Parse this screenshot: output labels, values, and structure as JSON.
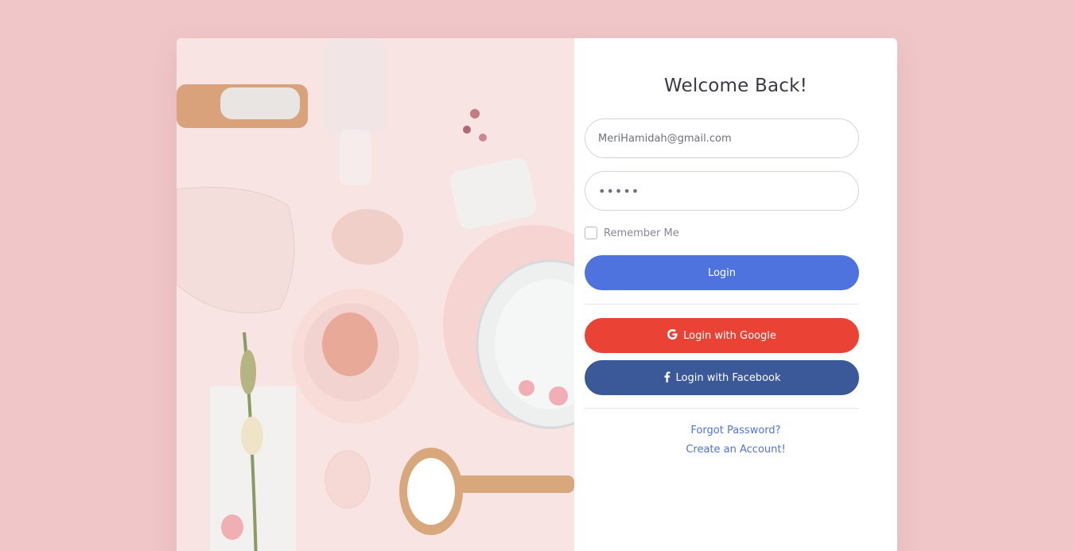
{
  "form": {
    "title": "Welcome Back!",
    "email_value": "MeriHamidah@gmail.com",
    "password_value": "•••••",
    "remember_label": "Remember Me",
    "remember_checked": false,
    "login_label": "Login",
    "google_label": "Login with Google",
    "google_icon": "google-icon",
    "facebook_label": "Login with Facebook",
    "facebook_icon": "facebook-icon",
    "forgot_link": "Forgot Password?",
    "create_link": "Create an Account!"
  },
  "colors": {
    "page_background": "#f0c6c8",
    "primary": "#4e73df",
    "google": "#ea4335",
    "facebook": "#3b5998"
  }
}
